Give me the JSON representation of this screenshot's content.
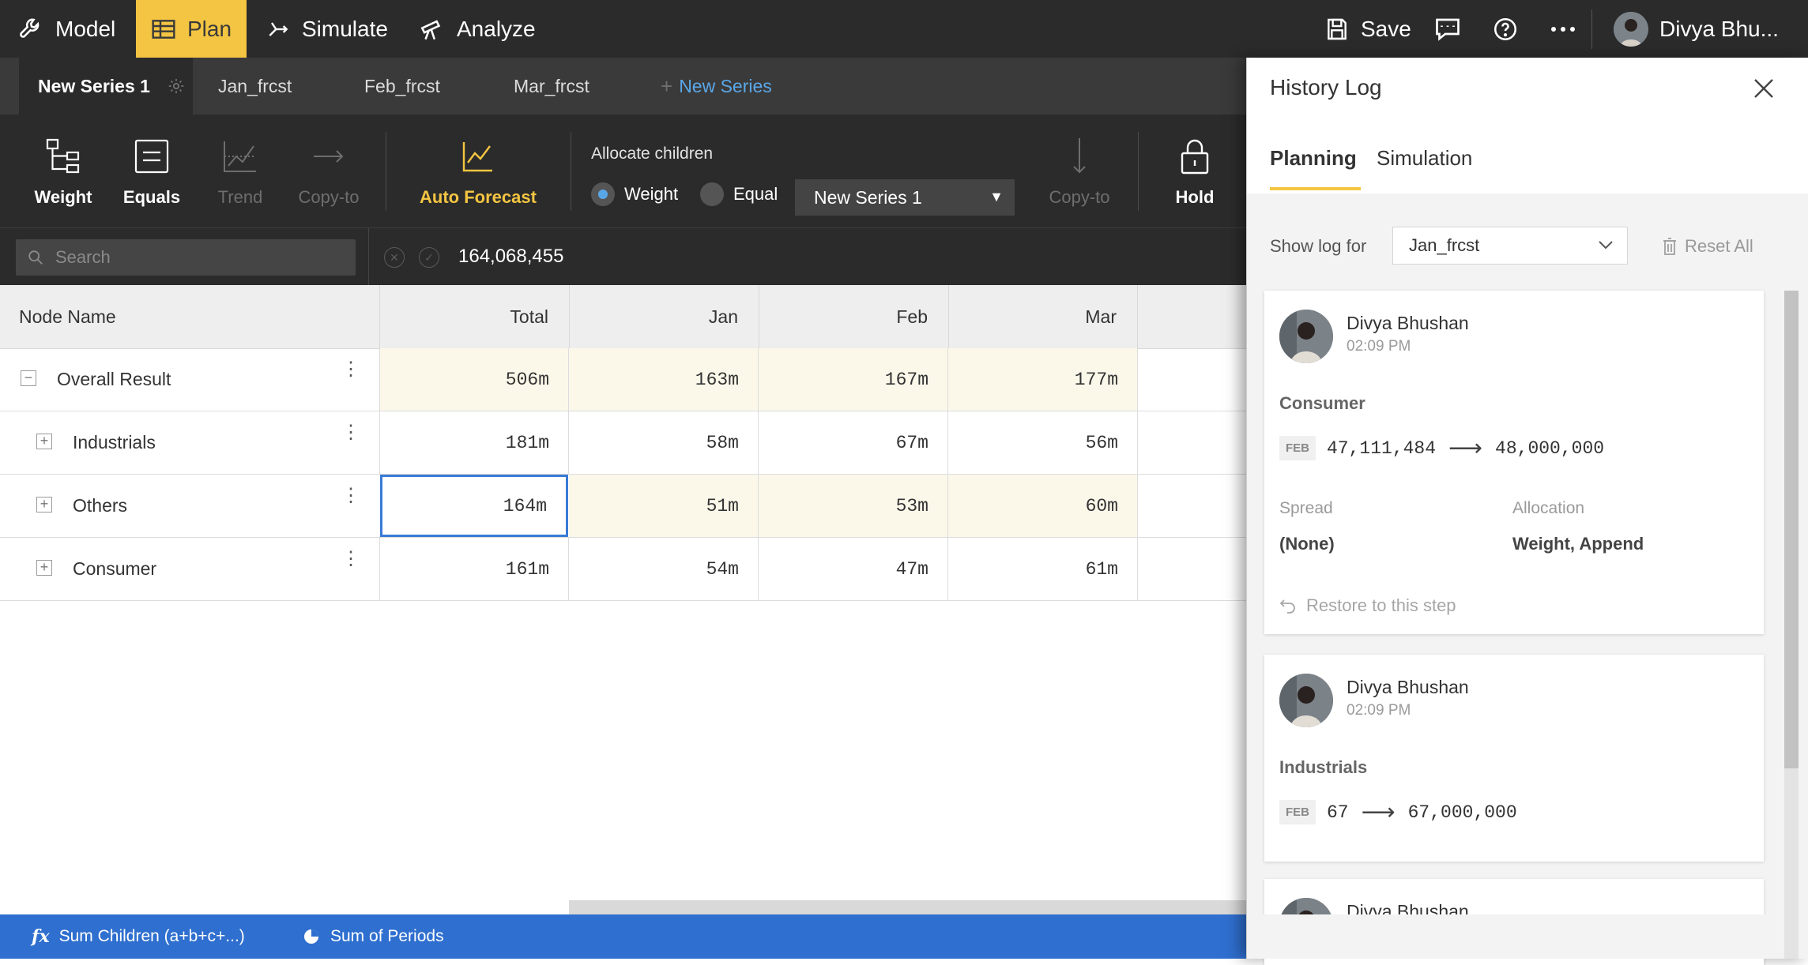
{
  "nav": {
    "items": [
      {
        "label": "Model",
        "icon": "wrench-icon"
      },
      {
        "label": "Plan",
        "icon": "table-icon"
      },
      {
        "label": "Simulate",
        "icon": "branch-icon"
      },
      {
        "label": "Analyze",
        "icon": "telescope-icon"
      }
    ],
    "save_label": "Save",
    "user_name": "Divya Bhu...",
    "accent_color": "#f4c542"
  },
  "series_tabs": [
    {
      "label": "New Series 1"
    },
    {
      "label": "Jan_frcst"
    },
    {
      "label": "Feb_frcst"
    },
    {
      "label": "Mar_frcst"
    }
  ],
  "new_series_label": "New Series",
  "toolbar": {
    "weight": "Weight",
    "equals": "Equals",
    "trend": "Trend",
    "copy_to": "Copy-to",
    "auto_forecast": "Auto Forecast",
    "allocate_label": "Allocate children",
    "radio_weight": "Weight",
    "radio_equal": "Equal",
    "series_select": "New Series 1",
    "copy_to_2": "Copy-to",
    "hold": "Hold"
  },
  "formula": {
    "search_placeholder": "Search",
    "value": "164,068,455"
  },
  "grid": {
    "columns": [
      "Node Name",
      "Total",
      "Jan",
      "Feb",
      "Mar"
    ],
    "rows": [
      {
        "name": "Overall Result",
        "total": "506m",
        "jan": "163m",
        "feb": "167m",
        "mar": "177m"
      },
      {
        "name": "Industrials",
        "total": "181m",
        "jan": "58m",
        "feb": "67m",
        "mar": "56m"
      },
      {
        "name": "Others",
        "total": "164m",
        "jan": "51m",
        "feb": "53m",
        "mar": "60m"
      },
      {
        "name": "Consumer",
        "total": "161m",
        "jan": "54m",
        "feb": "47m",
        "mar": "61m"
      }
    ]
  },
  "status": {
    "sum_children": "Sum Children (a+b+c+...)",
    "sum_periods": "Sum of Periods"
  },
  "history": {
    "title": "History Log",
    "tabs": [
      "Planning",
      "Simulation"
    ],
    "show_log_for": "Show log for",
    "log_select": "Jan_frcst",
    "reset_all": "Reset All",
    "entries": [
      {
        "user": "Divya Bhushan",
        "time": "02:09 PM",
        "node": "Consumer",
        "period": "FEB",
        "from": "47,111,484",
        "to": "48,000,000",
        "spread_label": "Spread",
        "spread_value": "(None)",
        "allocation_label": "Allocation",
        "allocation_value": "Weight, Append",
        "restore": "Restore to this step"
      },
      {
        "user": "Divya Bhushan",
        "time": "02:09 PM",
        "node": "Industrials",
        "period": "FEB",
        "from": "67",
        "to": "67,000,000"
      },
      {
        "user": "Divya Bhushan"
      }
    ]
  }
}
